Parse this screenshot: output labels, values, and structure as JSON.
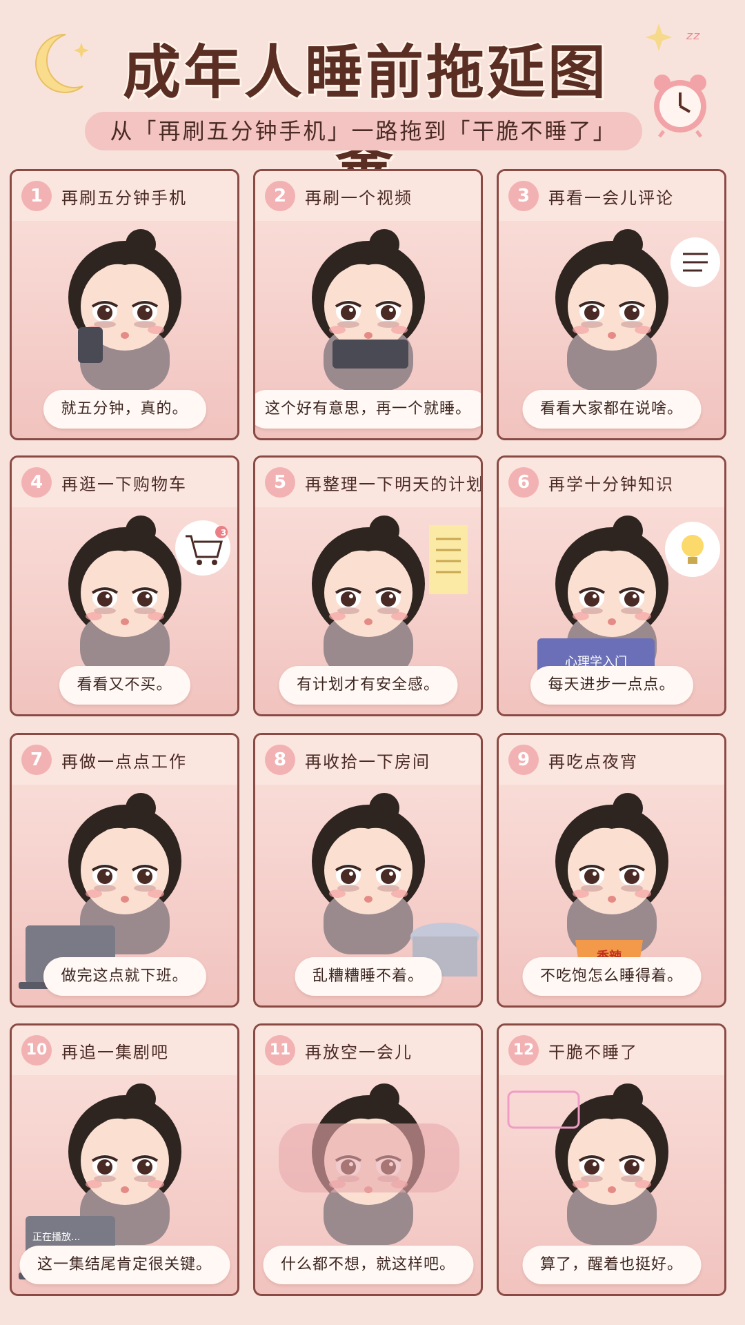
{
  "header": {
    "title": "成年人睡前拖延图鉴",
    "subtitle": "从「再刷五分钟手机」一路拖到「干脆不睡了」"
  },
  "colors": {
    "background": "#f7e3db",
    "panel_border": "#8a4a44",
    "badge": "#f2b2b3",
    "caption_bg": "#fff8f4",
    "subtitle_pill": "#f3c4c2"
  },
  "panels": [
    {
      "number": "1",
      "title": "再刷五分钟手机",
      "caption": "就五分钟，真的。",
      "prop": "phone-icon"
    },
    {
      "number": "2",
      "title": "再刷一个视频",
      "caption": "这个好有意思，再一个就睡。",
      "prop": "tablet-icon"
    },
    {
      "number": "3",
      "title": "再看一会儿评论",
      "caption": "看看大家都在说啥。",
      "prop": "comment-bubble-icon"
    },
    {
      "number": "4",
      "title": "再逛一下购物车",
      "caption": "看看又不买。",
      "prop": "cart-icon",
      "prop_count": "3"
    },
    {
      "number": "5",
      "title": "再整理一下明天的计划",
      "caption": "有计划才有安全感。",
      "prop": "note-icon"
    },
    {
      "number": "6",
      "title": "再学十分钟知识",
      "caption": "每天进步一点点。",
      "prop": "lightbulb-icon",
      "book_text": "心理学入门"
    },
    {
      "number": "7",
      "title": "再做一点点工作",
      "caption": "做完这点就下班。",
      "prop": "laptop-icon"
    },
    {
      "number": "8",
      "title": "再收拾一下房间",
      "caption": "乱糟糟睡不着。",
      "prop": "laundry-icon"
    },
    {
      "number": "9",
      "title": "再吃点夜宵",
      "caption": "不吃饱怎么睡得着。",
      "prop": "noodle-cup-icon",
      "cup_text": "香辣"
    },
    {
      "number": "10",
      "title": "再追一集剧吧",
      "caption": "这一集结尾肯定很关键。",
      "prop": "laptop-icon",
      "screen_text": "正在播放..."
    },
    {
      "number": "11",
      "title": "再放空一会儿",
      "caption": "什么都不想，就这样吧。",
      "prop": "pillow-icon"
    },
    {
      "number": "12",
      "title": "干脆不睡了",
      "caption": "算了，醒着也挺好。",
      "prop": "neon-sign-icon"
    }
  ]
}
